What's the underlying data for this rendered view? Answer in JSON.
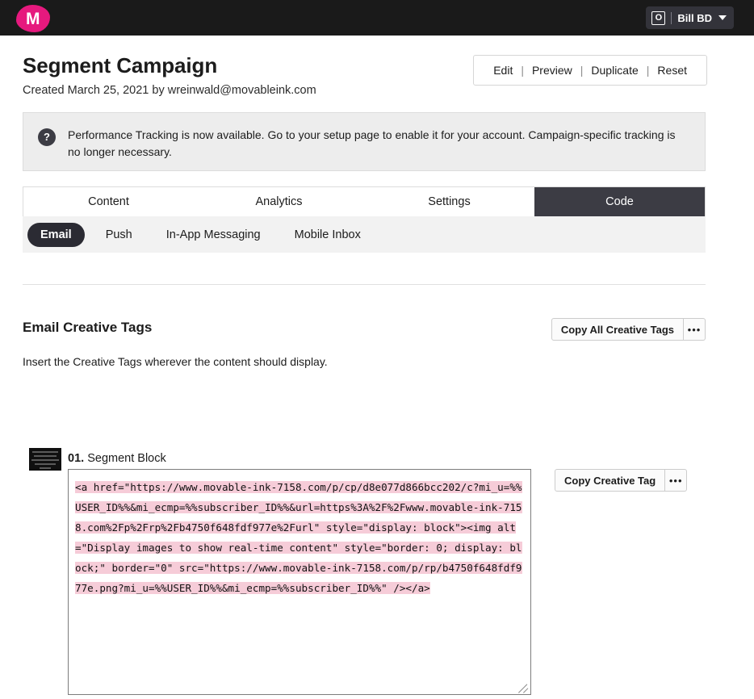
{
  "topbar": {
    "logo_letter": "M",
    "logo_color": "#e6197e",
    "user": {
      "badge_letter": "O",
      "name": "Bill BD"
    }
  },
  "header": {
    "title": "Segment Campaign",
    "subtitle": "Created March 25, 2021 by wreinwald@movableink.com",
    "actions": [
      {
        "label": "Edit"
      },
      {
        "label": "Preview"
      },
      {
        "label": "Duplicate"
      },
      {
        "label": "Reset"
      }
    ],
    "action_separator": "|"
  },
  "notice": {
    "icon": "?",
    "text": "Performance Tracking is now available. Go to your setup page to enable it for your account. Campaign-specific tracking is no longer necessary."
  },
  "tabs": [
    {
      "label": "Content",
      "active": false
    },
    {
      "label": "Analytics",
      "active": false
    },
    {
      "label": "Settings",
      "active": false
    },
    {
      "label": "Code",
      "active": true
    }
  ],
  "subtabs": [
    {
      "label": "Email",
      "active": true
    },
    {
      "label": "Push",
      "active": false
    },
    {
      "label": "In-App Messaging",
      "active": false
    },
    {
      "label": "Mobile Inbox",
      "active": false
    }
  ],
  "creative_tags": {
    "section_title": "Email Creative Tags",
    "description": "Insert the Creative Tags wherever the content should display.",
    "copy_all_label": "Copy All Creative Tags",
    "more_label": "•••",
    "block": {
      "number": "01.",
      "name": "Segment Block",
      "copy_label": "Copy Creative Tag",
      "more_label": "•••",
      "code": "<a href=\"https://www.movable-ink-7158.com/p/cp/d8e077d866bcc202/c?mi_u=%%USER_ID%%&mi_ecmp=%%subscriber_ID%%&url=https%3A%2F%2Fwww.movable-ink-7158.com%2Fp%2Frp%2Fb4750f648fdf977e%2Furl\" style=\"display: block\"><img alt=\"Display images to show real-time content\" style=\"border: 0; display: block;\" border=\"0\" src=\"https://www.movable-ink-7158.com/p/rp/b4750f648fdf977e.png?mi_u=%%USER_ID%%&mi_ecmp=%%subscriber_ID%%\" /></a>"
    }
  }
}
